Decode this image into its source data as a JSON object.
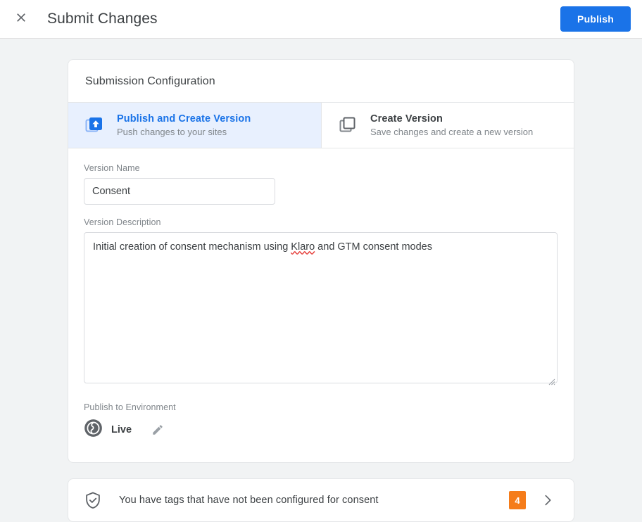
{
  "header": {
    "close_icon": "close-icon",
    "title": "Submit Changes",
    "publish_label": "Publish",
    "publish_color": "#1a73e8"
  },
  "card": {
    "title": "Submission Configuration",
    "tabs": [
      {
        "icon": "publish-version-icon",
        "title": "Publish and Create Version",
        "subtitle": "Push changes to your sites",
        "active": true,
        "active_bg": "#e8f0fe",
        "active_fg": "#1a73e8"
      },
      {
        "icon": "copy-version-icon",
        "title": "Create Version",
        "subtitle": "Save changes and create a new version",
        "active": false
      }
    ],
    "version_name": {
      "label": "Version Name",
      "value": "Consent",
      "placeholder": ""
    },
    "version_description": {
      "label": "Version Description",
      "value": "Initial creation of consent mechanism using Klaro and GTM consent modes",
      "value_before_misspelling": "Initial creation of consent mechanism using ",
      "misspelled_word": "Klaro",
      "value_after_misspelling": " and GTM consent modes",
      "placeholder": ""
    },
    "environment": {
      "label": "Publish to Environment",
      "icon": "public-globe-icon",
      "name": "Live",
      "edit_icon": "pencil-edit-icon"
    }
  },
  "alert": {
    "icon": "shield-check-icon",
    "message": "You have tags that have not been configured for consent",
    "badge_count": "4",
    "badge_color": "#f57c1a",
    "chevron_icon": "chevron-right-icon"
  }
}
